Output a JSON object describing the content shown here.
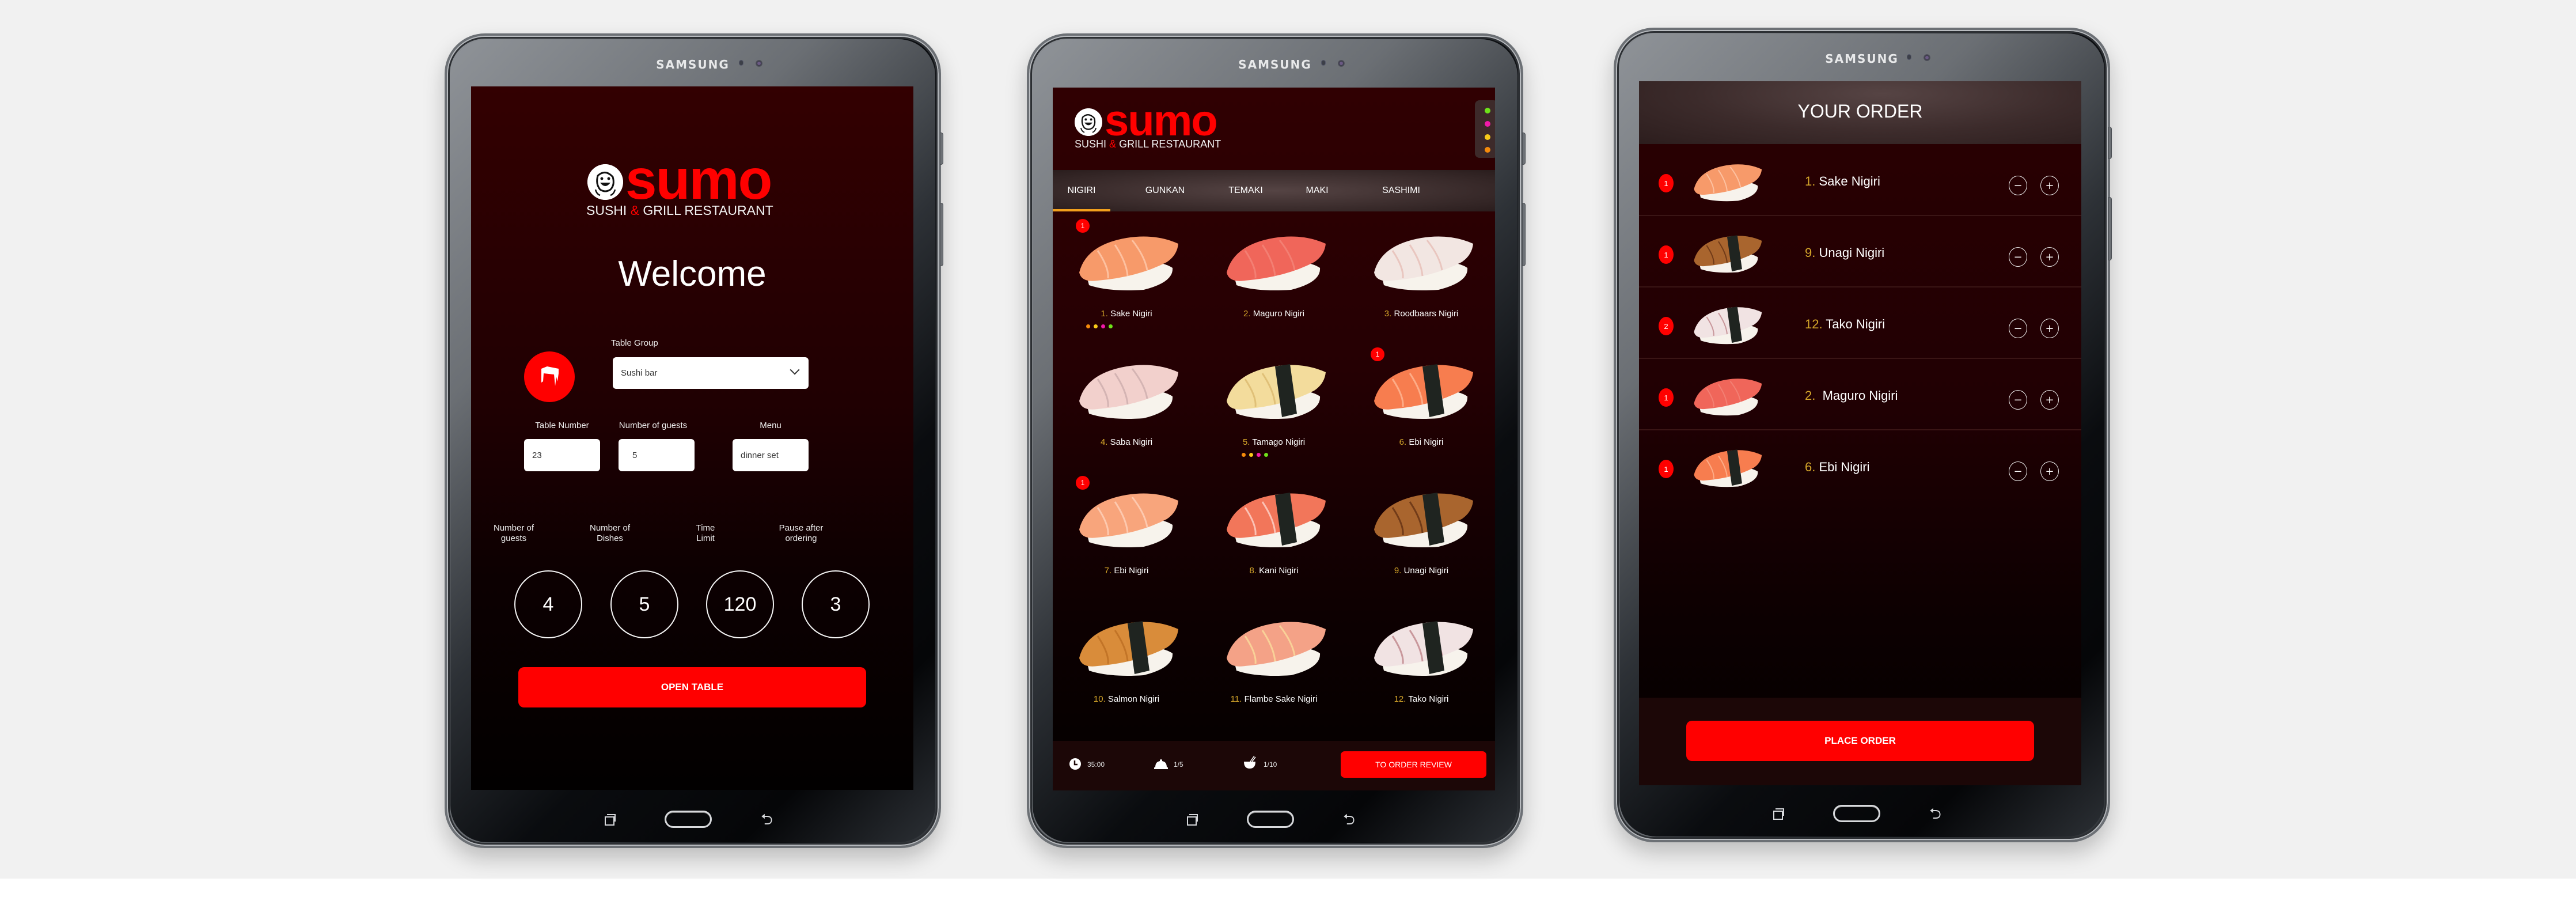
{
  "device": {
    "brand": "SAMSUNG"
  },
  "logo": {
    "word": "sumo",
    "subtitle_left": "SUSHI",
    "subtitle_amp": "&",
    "subtitle_right": "GRILL RESTAURANT"
  },
  "welcome_screen": {
    "title": "Welcome",
    "table_group": {
      "label": "Table Group",
      "value": "Sushi bar"
    },
    "table_number": {
      "label": "Table Number",
      "value": "23"
    },
    "number_of_guests": {
      "label": "Number of guests",
      "value": "5"
    },
    "menu": {
      "label": "Menu",
      "value": "dinner set"
    },
    "stats": [
      {
        "label_line1": "Number of",
        "label_line2": "guests",
        "value": "4"
      },
      {
        "label_line1": "Number of",
        "label_line2": "Dishes",
        "value": "5"
      },
      {
        "label_line1": "Time",
        "label_line2": "Limit",
        "value": "120"
      },
      {
        "label_line1": "Pause after",
        "label_line2": "ordering",
        "value": "3"
      }
    ],
    "open_table_button": "OPEN TABLE"
  },
  "menu_screen": {
    "tabs": [
      {
        "label": "NIGIRI",
        "active": true
      },
      {
        "label": "GUNKAN",
        "active": false
      },
      {
        "label": "TEMAKI",
        "active": false
      },
      {
        "label": "MAKI",
        "active": false
      },
      {
        "label": "SASHIMI",
        "active": false
      }
    ],
    "status_dots": [
      "#6ee21a",
      "#f01aa8",
      "#f7c919",
      "#f58a0b"
    ],
    "items": [
      {
        "num": "1.",
        "name": "Sake Nigiri",
        "qty": "1",
        "tags": [
          "#f58a0b",
          "#f7c919",
          "#f01aa8",
          "#6ee21a"
        ],
        "image": "salmon-nigiri"
      },
      {
        "num": "2.",
        "name": " Maguro Nigiri",
        "qty": null,
        "tags": [],
        "image": "tuna-nigiri"
      },
      {
        "num": "3.",
        "name": "Roodbaars Nigiri",
        "qty": null,
        "tags": [],
        "image": "redfish-nigiri"
      },
      {
        "num": "4.",
        "name": "Saba Nigiri",
        "qty": null,
        "tags": [],
        "image": "mackerel-nigiri"
      },
      {
        "num": "5.",
        "name": "Tamago Nigiri",
        "qty": null,
        "tags": [
          "#f58a0b",
          "#f7c919",
          "#f01aa8",
          "#6ee21a"
        ],
        "image": "egg-nigiri"
      },
      {
        "num": "6.",
        "name": "Ebi Nigiri",
        "qty": "1",
        "tags": [],
        "image": "shrimp-nori-nigiri"
      },
      {
        "num": "7.",
        "name": "Ebi Nigiri",
        "qty": "1",
        "tags": [],
        "image": "shrimp-nigiri"
      },
      {
        "num": "8.",
        "name": "Kani Nigiri",
        "qty": null,
        "tags": [],
        "image": "crab-nigiri"
      },
      {
        "num": "9.",
        "name": "Unagi Nigiri",
        "qty": null,
        "tags": [],
        "image": "eel-nigiri"
      },
      {
        "num": "10.",
        "name": "Salmon Nigiri",
        "qty": null,
        "tags": [],
        "image": "inari-nigiri"
      },
      {
        "num": "11.",
        "name": "Flambe Sake Nigiri",
        "qty": null,
        "tags": [],
        "image": "flambe-salmon-nigiri"
      },
      {
        "num": "12.",
        "name": "Tako Nigiri",
        "qty": null,
        "tags": [],
        "image": "octopus-nigiri"
      }
    ],
    "bottom_bar": {
      "timer": "35:00",
      "rounds": "1/5",
      "dishes": "1/10",
      "order_review_button": "TO ORDER REVIEW"
    }
  },
  "order_screen": {
    "title": "YOUR ORDER",
    "items": [
      {
        "qty": "1",
        "num": "1.",
        "name": " Sake Nigiri",
        "image": "salmon-nigiri"
      },
      {
        "qty": "1",
        "num": "9.",
        "name": " Unagi Nigiri",
        "image": "eel-nigiri"
      },
      {
        "qty": "2",
        "num": "12.",
        "name": " Tako Nigiri",
        "image": "octopus-nigiri"
      },
      {
        "qty": "1",
        "num": "2.",
        "name": "  Maguro Nigiri",
        "image": "tuna-nigiri"
      },
      {
        "qty": "1",
        "num": "6.",
        "name": " Ebi Nigiri",
        "image": "shrimp-nori-nigiri"
      }
    ],
    "minus_label": "−",
    "plus_label": "+",
    "place_order_button": "PLACE ORDER"
  },
  "colors": {
    "accent_red": "#ff0000",
    "number_gold": "#d4a52a",
    "tab_underline": "#f2a01d"
  }
}
